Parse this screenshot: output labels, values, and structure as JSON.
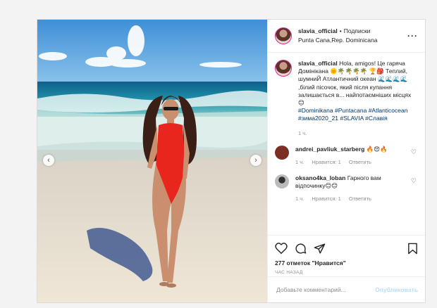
{
  "post": {
    "username": "slavia_official",
    "follow_label": "Подписки",
    "location": "Punta Cana,Rep. Dominicana",
    "more_icon": "more-options-icon",
    "caption": {
      "username": "slavia_official",
      "text": "Hola, amigos! Це гаряча Домінікана 🌞🌴🌴🌴🌴 🏆🎒 Теплий, шумниЙ Атлантичний океан 🌊🌊🌊🌊 ,білий пісочок, який після купання залишається в... найпотаємніших місцях 😊",
      "hashtags": "#Dominikana #Puntacana #Atlanticocean #зима2020_21 #SLAVIA #Славія",
      "time": "1 ч."
    },
    "comments": [
      {
        "username": "andrei_pavliuk_starberg",
        "text": "🔥😍🔥",
        "time": "1 ч.",
        "likes": "Нравится: 1",
        "reply": "Ответить",
        "avatar_color": "#7a2f22"
      },
      {
        "username": "oksano4ka_loban",
        "text": "Гарного вам відпочинку😊😊",
        "time": "1 ч.",
        "likes": "Нравится: 1",
        "reply": "Ответить",
        "avatar_color": "#9a9a9a"
      }
    ],
    "likes_text": "277 отметок \"Нравится\"",
    "time_ago": "ЧАС НАЗАД",
    "add_comment_placeholder": "Добавьте комментарий...",
    "publish_label": "Опубликовать",
    "nav_prev": "‹",
    "nav_next": "›"
  }
}
